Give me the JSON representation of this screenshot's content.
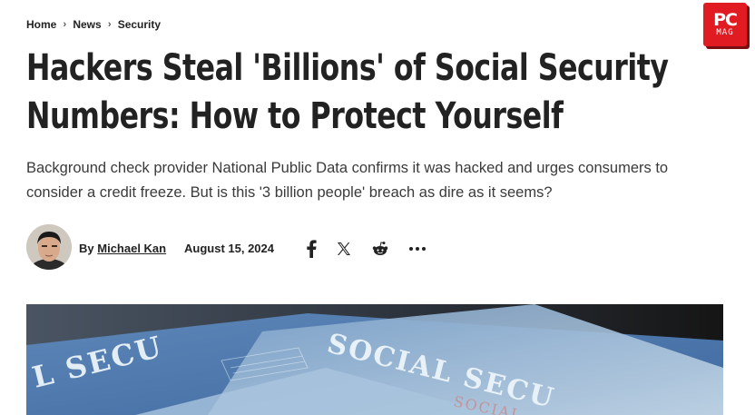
{
  "breadcrumb": {
    "items": [
      "Home",
      "News",
      "Security"
    ]
  },
  "brand": {
    "line1": "PC",
    "line2": "MAG",
    "color": "#e11b22"
  },
  "article": {
    "title": "Hackers Steal 'Billions' of Social Security Numbers: How to Protect Yourself",
    "subtitle": "Background check provider National Public Data confirms it was hacked and urges consumers to consider a credit freeze. But is this '3 billion people' breach as dire as it seems?",
    "byline_prefix": "By",
    "author": "Michael Kan",
    "date": "August 15, 2024"
  },
  "share_icons": [
    "facebook-icon",
    "x-icon",
    "reddit-icon",
    "more-icon"
  ],
  "hero_card_text": [
    "SOCIAL SECU",
    "L SECU",
    "SOCIAL"
  ]
}
